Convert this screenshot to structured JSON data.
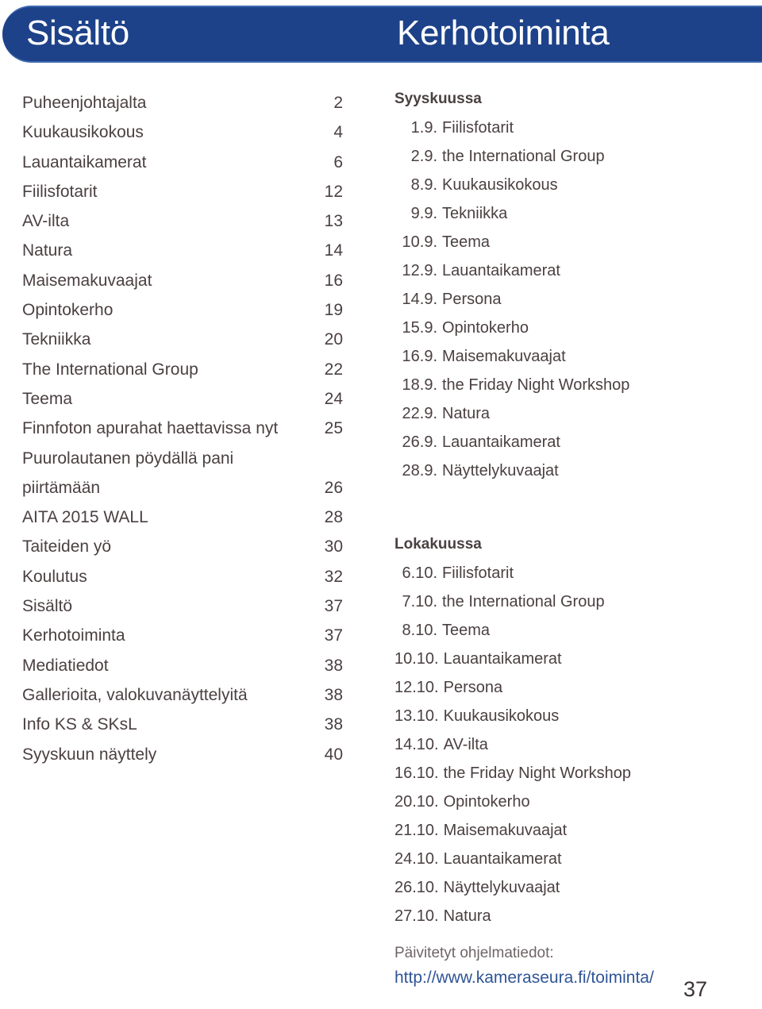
{
  "header": {
    "left_title": "Sisältö",
    "right_title": "Kerhotoiminta",
    "bar_color": "#1d4289",
    "bar_edge_color": "#3f6cb0",
    "text_color": "#ffffff"
  },
  "toc": {
    "entries": [
      {
        "label": "Puheenjohtajalta",
        "page": "2",
        "leader": true
      },
      {
        "label": "Kuukausikokous",
        "page": "4",
        "leader": true
      },
      {
        "label": "Lauantaikamerat",
        "page": "6",
        "leader": true
      },
      {
        "label": "Fiilisfotarit",
        "page": "12",
        "leader": true
      },
      {
        "label": "AV-ilta",
        "page": "13",
        "leader": true
      },
      {
        "label": "Natura",
        "page": "14",
        "leader": true
      },
      {
        "label": "Maisemakuvaajat",
        "page": "16",
        "leader": true
      },
      {
        "label": "Opintokerho",
        "page": "19",
        "leader": true
      },
      {
        "label": "Tekniikka",
        "page": "20",
        "leader": true
      },
      {
        "label": "The International Group",
        "page": "22",
        "leader": true
      },
      {
        "label": "Teema",
        "page": "24",
        "leader": true
      },
      {
        "label": "Finnfoton apurahat haettavissa nyt",
        "page": "25",
        "leader": true
      },
      {
        "label": "Puurolautanen pöydällä pani",
        "page": "",
        "leader": false
      },
      {
        "label": "piirtämään",
        "page": "26",
        "leader": true
      },
      {
        "label": "AITA 2015 WALL",
        "page": "28",
        "leader": true
      },
      {
        "label": "Taiteiden yö",
        "page": "30",
        "leader": true
      },
      {
        "label": "Koulutus",
        "page": "32",
        "leader": true
      },
      {
        "label": "Sisältö",
        "page": "37",
        "leader": true
      },
      {
        "label": "Kerhotoiminta",
        "page": "37",
        "leader": true
      },
      {
        "label": "Mediatiedot",
        "page": "38",
        "leader": true
      },
      {
        "label": "Gallerioita, valokuvanäyttelyitä",
        "page": "38",
        "leader": true
      },
      {
        "label": "Info KS & SKsL",
        "page": "38",
        "leader": true
      },
      {
        "label": "Syyskuun näyttely",
        "page": "40",
        "leader": true
      }
    ]
  },
  "programme": {
    "months": [
      {
        "heading": "Syyskuussa",
        "events": [
          {
            "date": "1.9.",
            "name": "Fiilisfotarit"
          },
          {
            "date": "2.9.",
            "name": "the International Group"
          },
          {
            "date": "8.9.",
            "name": "Kuukausikokous"
          },
          {
            "date": "9.9.",
            "name": "Tekniikka"
          },
          {
            "date": "10.9.",
            "name": "Teema"
          },
          {
            "date": "12.9.",
            "name": "Lauantaikamerat"
          },
          {
            "date": "14.9.",
            "name": "Persona"
          },
          {
            "date": "15.9.",
            "name": "Opintokerho"
          },
          {
            "date": "16.9.",
            "name": "Maisemakuvaajat"
          },
          {
            "date": "18.9.",
            "name": "the Friday Night Workshop"
          },
          {
            "date": "22.9.",
            "name": "Natura"
          },
          {
            "date": "26.9.",
            "name": "Lauantaikamerat"
          },
          {
            "date": "28.9.",
            "name": "Näyttelykuvaajat"
          }
        ]
      },
      {
        "heading": "Lokakuussa",
        "events": [
          {
            "date": "6.10.",
            "name": "Fiilisfotarit"
          },
          {
            "date": "7.10.",
            "name": "the International Group"
          },
          {
            "date": "8.10.",
            "name": "Teema"
          },
          {
            "date": "10.10.",
            "name": "Lauantaikamerat"
          },
          {
            "date": "12.10.",
            "name": "Persona"
          },
          {
            "date": "13.10.",
            "name": "Kuukausikokous"
          },
          {
            "date": "14.10.",
            "name": "AV-ilta"
          },
          {
            "date": "16.10.",
            "name": "the Friday Night Workshop"
          },
          {
            "date": "20.10.",
            "name": "Opintokerho"
          },
          {
            "date": "21.10.",
            "name": "Maisemakuvaajat"
          },
          {
            "date": "24.10.",
            "name": "Lauantaikamerat"
          },
          {
            "date": "26.10.",
            "name": "Näyttelykuvaajat"
          },
          {
            "date": "27.10.",
            "name": "Natura"
          }
        ]
      }
    ]
  },
  "footer": {
    "label": "Päivitetyt ohjelmatiedot:",
    "url": "http://www.kameraseura.fi/toiminta/",
    "url_color": "#2f5596",
    "page_number": "37"
  }
}
